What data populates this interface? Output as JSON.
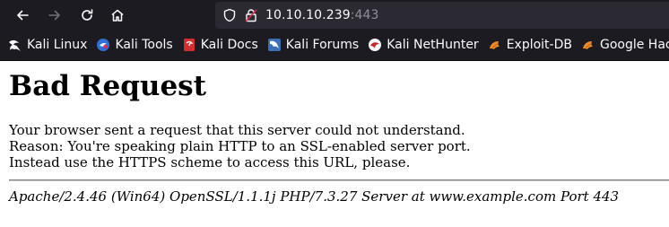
{
  "browser": {
    "url_host": "10.10.10.239",
    "url_port": ":443",
    "icons": {
      "back": "back-arrow-icon",
      "forward": "forward-arrow-icon",
      "reload": "reload-icon",
      "home": "home-icon",
      "shield": "shield-icon",
      "lock": "insecure-lock-icon"
    }
  },
  "bookmarks": [
    {
      "label": "Kali Linux",
      "icon": "kali-dragon-icon"
    },
    {
      "label": "Kali Tools",
      "icon": "kali-tools-icon"
    },
    {
      "label": "Kali Docs",
      "icon": "kali-docs-icon"
    },
    {
      "label": "Kali Forums",
      "icon": "kali-forums-icon"
    },
    {
      "label": "Kali NetHunter",
      "icon": "nethunter-icon"
    },
    {
      "label": "Exploit-DB",
      "icon": "exploit-db-icon"
    },
    {
      "label": "Google Hacking",
      "icon": "ghdb-icon"
    }
  ],
  "page": {
    "heading": "Bad Request",
    "line1": "Your browser sent a request that this server could not understand.",
    "line2": "Reason: You're speaking plain HTTP to an SSL-enabled server port.",
    "line3": "Instead use the HTTPS scheme to access this URL, please.",
    "address": "Apache/2.4.46 (Win64) OpenSSL/1.1.1j PHP/7.3.27 Server at www.example.com Port 443"
  }
}
